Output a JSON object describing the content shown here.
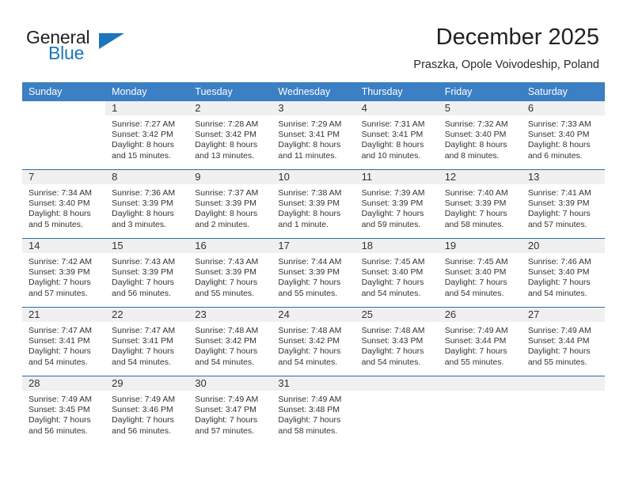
{
  "brand": {
    "name_part1": "General",
    "name_part2": "Blue",
    "accent_color": "#1b75bb"
  },
  "header": {
    "month_title": "December 2025",
    "location": "Praszka, Opole Voivodeship, Poland"
  },
  "calendar": {
    "header_color": "#3b7fc4",
    "weekday_headers": [
      "Sunday",
      "Monday",
      "Tuesday",
      "Wednesday",
      "Thursday",
      "Friday",
      "Saturday"
    ],
    "weeks": [
      [
        {
          "day": "",
          "blank": true,
          "sunrise": "",
          "sunset": "",
          "daylight1": "",
          "daylight2": ""
        },
        {
          "day": "1",
          "sunrise": "Sunrise: 7:27 AM",
          "sunset": "Sunset: 3:42 PM",
          "daylight1": "Daylight: 8 hours",
          "daylight2": "and 15 minutes."
        },
        {
          "day": "2",
          "sunrise": "Sunrise: 7:28 AM",
          "sunset": "Sunset: 3:42 PM",
          "daylight1": "Daylight: 8 hours",
          "daylight2": "and 13 minutes."
        },
        {
          "day": "3",
          "sunrise": "Sunrise: 7:29 AM",
          "sunset": "Sunset: 3:41 PM",
          "daylight1": "Daylight: 8 hours",
          "daylight2": "and 11 minutes."
        },
        {
          "day": "4",
          "sunrise": "Sunrise: 7:31 AM",
          "sunset": "Sunset: 3:41 PM",
          "daylight1": "Daylight: 8 hours",
          "daylight2": "and 10 minutes."
        },
        {
          "day": "5",
          "sunrise": "Sunrise: 7:32 AM",
          "sunset": "Sunset: 3:40 PM",
          "daylight1": "Daylight: 8 hours",
          "daylight2": "and 8 minutes."
        },
        {
          "day": "6",
          "sunrise": "Sunrise: 7:33 AM",
          "sunset": "Sunset: 3:40 PM",
          "daylight1": "Daylight: 8 hours",
          "daylight2": "and 6 minutes."
        }
      ],
      [
        {
          "day": "7",
          "sunrise": "Sunrise: 7:34 AM",
          "sunset": "Sunset: 3:40 PM",
          "daylight1": "Daylight: 8 hours",
          "daylight2": "and 5 minutes."
        },
        {
          "day": "8",
          "sunrise": "Sunrise: 7:36 AM",
          "sunset": "Sunset: 3:39 PM",
          "daylight1": "Daylight: 8 hours",
          "daylight2": "and 3 minutes."
        },
        {
          "day": "9",
          "sunrise": "Sunrise: 7:37 AM",
          "sunset": "Sunset: 3:39 PM",
          "daylight1": "Daylight: 8 hours",
          "daylight2": "and 2 minutes."
        },
        {
          "day": "10",
          "sunrise": "Sunrise: 7:38 AM",
          "sunset": "Sunset: 3:39 PM",
          "daylight1": "Daylight: 8 hours",
          "daylight2": "and 1 minute."
        },
        {
          "day": "11",
          "sunrise": "Sunrise: 7:39 AM",
          "sunset": "Sunset: 3:39 PM",
          "daylight1": "Daylight: 7 hours",
          "daylight2": "and 59 minutes."
        },
        {
          "day": "12",
          "sunrise": "Sunrise: 7:40 AM",
          "sunset": "Sunset: 3:39 PM",
          "daylight1": "Daylight: 7 hours",
          "daylight2": "and 58 minutes."
        },
        {
          "day": "13",
          "sunrise": "Sunrise: 7:41 AM",
          "sunset": "Sunset: 3:39 PM",
          "daylight1": "Daylight: 7 hours",
          "daylight2": "and 57 minutes."
        }
      ],
      [
        {
          "day": "14",
          "sunrise": "Sunrise: 7:42 AM",
          "sunset": "Sunset: 3:39 PM",
          "daylight1": "Daylight: 7 hours",
          "daylight2": "and 57 minutes."
        },
        {
          "day": "15",
          "sunrise": "Sunrise: 7:43 AM",
          "sunset": "Sunset: 3:39 PM",
          "daylight1": "Daylight: 7 hours",
          "daylight2": "and 56 minutes."
        },
        {
          "day": "16",
          "sunrise": "Sunrise: 7:43 AM",
          "sunset": "Sunset: 3:39 PM",
          "daylight1": "Daylight: 7 hours",
          "daylight2": "and 55 minutes."
        },
        {
          "day": "17",
          "sunrise": "Sunrise: 7:44 AM",
          "sunset": "Sunset: 3:39 PM",
          "daylight1": "Daylight: 7 hours",
          "daylight2": "and 55 minutes."
        },
        {
          "day": "18",
          "sunrise": "Sunrise: 7:45 AM",
          "sunset": "Sunset: 3:40 PM",
          "daylight1": "Daylight: 7 hours",
          "daylight2": "and 54 minutes."
        },
        {
          "day": "19",
          "sunrise": "Sunrise: 7:45 AM",
          "sunset": "Sunset: 3:40 PM",
          "daylight1": "Daylight: 7 hours",
          "daylight2": "and 54 minutes."
        },
        {
          "day": "20",
          "sunrise": "Sunrise: 7:46 AM",
          "sunset": "Sunset: 3:40 PM",
          "daylight1": "Daylight: 7 hours",
          "daylight2": "and 54 minutes."
        }
      ],
      [
        {
          "day": "21",
          "sunrise": "Sunrise: 7:47 AM",
          "sunset": "Sunset: 3:41 PM",
          "daylight1": "Daylight: 7 hours",
          "daylight2": "and 54 minutes."
        },
        {
          "day": "22",
          "sunrise": "Sunrise: 7:47 AM",
          "sunset": "Sunset: 3:41 PM",
          "daylight1": "Daylight: 7 hours",
          "daylight2": "and 54 minutes."
        },
        {
          "day": "23",
          "sunrise": "Sunrise: 7:48 AM",
          "sunset": "Sunset: 3:42 PM",
          "daylight1": "Daylight: 7 hours",
          "daylight2": "and 54 minutes."
        },
        {
          "day": "24",
          "sunrise": "Sunrise: 7:48 AM",
          "sunset": "Sunset: 3:42 PM",
          "daylight1": "Daylight: 7 hours",
          "daylight2": "and 54 minutes."
        },
        {
          "day": "25",
          "sunrise": "Sunrise: 7:48 AM",
          "sunset": "Sunset: 3:43 PM",
          "daylight1": "Daylight: 7 hours",
          "daylight2": "and 54 minutes."
        },
        {
          "day": "26",
          "sunrise": "Sunrise: 7:49 AM",
          "sunset": "Sunset: 3:44 PM",
          "daylight1": "Daylight: 7 hours",
          "daylight2": "and 55 minutes."
        },
        {
          "day": "27",
          "sunrise": "Sunrise: 7:49 AM",
          "sunset": "Sunset: 3:44 PM",
          "daylight1": "Daylight: 7 hours",
          "daylight2": "and 55 minutes."
        }
      ],
      [
        {
          "day": "28",
          "sunrise": "Sunrise: 7:49 AM",
          "sunset": "Sunset: 3:45 PM",
          "daylight1": "Daylight: 7 hours",
          "daylight2": "and 56 minutes."
        },
        {
          "day": "29",
          "sunrise": "Sunrise: 7:49 AM",
          "sunset": "Sunset: 3:46 PM",
          "daylight1": "Daylight: 7 hours",
          "daylight2": "and 56 minutes."
        },
        {
          "day": "30",
          "sunrise": "Sunrise: 7:49 AM",
          "sunset": "Sunset: 3:47 PM",
          "daylight1": "Daylight: 7 hours",
          "daylight2": "and 57 minutes."
        },
        {
          "day": "31",
          "sunrise": "Sunrise: 7:49 AM",
          "sunset": "Sunset: 3:48 PM",
          "daylight1": "Daylight: 7 hours",
          "daylight2": "and 58 minutes."
        },
        {
          "day": "",
          "empty": true,
          "sunrise": "",
          "sunset": "",
          "daylight1": "",
          "daylight2": ""
        },
        {
          "day": "",
          "empty": true,
          "sunrise": "",
          "sunset": "",
          "daylight1": "",
          "daylight2": ""
        },
        {
          "day": "",
          "empty": true,
          "sunrise": "",
          "sunset": "",
          "daylight1": "",
          "daylight2": ""
        }
      ]
    ]
  }
}
